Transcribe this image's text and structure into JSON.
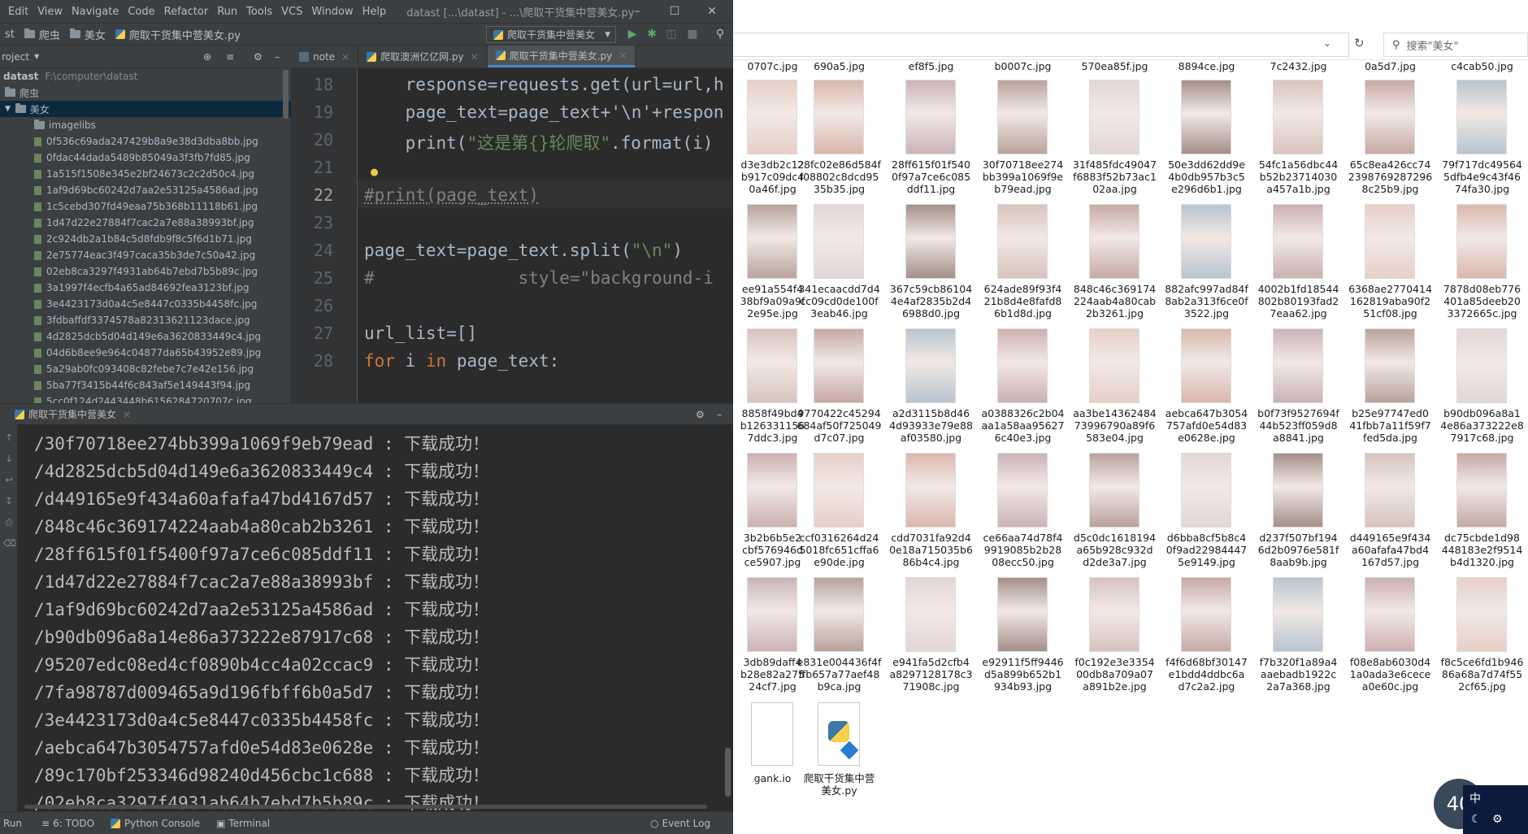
{
  "ide": {
    "menu": [
      "Edit",
      "View",
      "Navigate",
      "Code",
      "Refactor",
      "Run",
      "Tools",
      "VCS",
      "Window",
      "Help"
    ],
    "window_title": "datast [...\\datast] - ...\\爬取干货集中营美女.py",
    "breadcrumbs": [
      "st",
      "爬虫",
      "美女",
      "爬取干货集中营美女.py"
    ],
    "run_config": "爬取干货集中营美女",
    "project_label": "roject",
    "tabs": [
      {
        "label": "note",
        "active": false
      },
      {
        "label": "爬取澳洲亿亿网.py",
        "active": false
      },
      {
        "label": "爬取干货集中营美女.py",
        "active": true
      }
    ],
    "tree": {
      "root": "datast",
      "root_path": "F:\\computer\\datast",
      "folder1": "爬虫",
      "folder2": "美女",
      "folder3": "imagelibs",
      "files": [
        "0f536c69ada247429b8a9e38d3dba8bb.jpg",
        "0fdac44dada5489b85049a3f3fb7fd85.jpg",
        "1a515f1508e345e2bf24673c2c2d50c4.jpg",
        "1af9d69bc60242d7aa2e53125a4586ad.jpg",
        "1c5cebd307fd49eaa75b368b11118b61.jpg",
        "1d47d22e27884f7cac2a7e88a38993bf.jpg",
        "2c924db2a1b84c5d8fdb9f8c5f6d1b71.jpg",
        "2e75774eac3f497caca35b3de7c50a42.jpg",
        "02eb8ca3297f4931ab64b7ebd7b5b89c.jpg",
        "3a1997f4ecfb4a65ad84692fea3123bf.jpg",
        "3e4423173d0a4c5e8447c0335b4458fc.jpg",
        "3fdbaffdf3374578a82313621123dace.jpg",
        "4d2825dcb5d04d149e6a3620833449c4.jpg",
        "04d6b8ee9e964c04877da65b43952e89.jpg",
        "5a29ab0fc093408c82febe7c7e42e156.jpg",
        "5ba77f3415b44f6c843af5e149443f94.jpg",
        "5cc0f124d2443448b6156284720707c.jpg"
      ]
    },
    "line_numbers": [
      "18",
      "19",
      "20",
      "21",
      "22",
      "23",
      "24",
      "25",
      "26",
      "27",
      "28"
    ],
    "code": {
      "l18": "    response=requests.get(url=url,h",
      "l19": "    page_text=page_text+'\\n'+respon",
      "l20_a": "    print(",
      "l20_b": "\"这是第{}轮爬取\"",
      "l20_c": ".format(i)",
      "l22": "#print(page_text)",
      "l24_a": "page_text=page_text.split(",
      "l24_b": "\"\\n\"",
      "l24_c": ")",
      "l25": "#              style=\"background-i",
      "l27": "url_list=[]",
      "l28_kw1": "for",
      "l28_mid": " i ",
      "l28_kw2": "in",
      "l28_end": " page_text:"
    },
    "run_tab": "爬取干货集中营美女",
    "console": [
      "/30f70718ee274bb399a1069f9eb79ead : 下载成功！",
      "/4d2825dcb5d04d149e6a3620833449c4 : 下载成功！",
      "/d449165e9f434a60afafa47bd4167d57 : 下载成功！",
      "/848c46c369174224aab4a80cab2b3261 : 下载成功！",
      "/28ff615f01f5400f97a7ce6c085ddf11 : 下载成功！",
      "/1d47d22e27884f7cac2a7e88a38993bf : 下载成功！",
      "/1af9d69bc60242d7aa2e53125a4586ad : 下载成功！",
      "/b90db096a8a14e86a373222e87917c68 : 下载成功！",
      "/95207edc08ed4cf0890b4cc4a02ccac9 : 下载成功！",
      "/7fa98787d009465a9d196fbff6b0a5d7 : 下载成功！",
      "/3e4423173d0a4c5e8447c0335b4458fc : 下载成功！",
      "/aebca647b3054757afd0e54d83e0628e : 下载成功！",
      "/89c170bf253346d98240d456cbc1c688 : 下载成功！",
      "/02eb8ca3297f4931ab64b7ebd7b5b89c : 下载成功！"
    ],
    "status": {
      "run": "Run",
      "todo": "6: TODO",
      "python_console": "Python Console",
      "terminal": "Terminal",
      "event_log": "Event Log"
    }
  },
  "explorer": {
    "search_placeholder": "搜索\"美女\"",
    "top_row": [
      "0707c.jpg",
      "690a5.jpg",
      "ef8f5.jpg",
      "b0007c.jpg",
      "570ea85f.jpg",
      "8894ce.jpg",
      "7c2432.jpg",
      "0a5d7.jpg",
      "c4cab50.jpg"
    ],
    "rows": [
      [
        "d3e3db2c12\nb917c09dc4\n0a46f.jpg",
        "28fc02e86d584f\nf08802c8dcd95\n35b35.jpg",
        "28ff615f01f540\n0f97a7ce6c085\nddf11.jpg",
        "30f70718ee274\nbb399a1069f9e\nb79ead.jpg",
        "31f485fdc49047\nf6883f52b73ac1\n02aa.jpg",
        "50e3dd62dd9e\n4b0db957b3c5\ne296d6b1.jpg",
        "54fc1a56dbc44\nb52b23714030\na457a1b.jpg",
        "65c8ea426cc74\n2398769287296\n8c25b9.jpg",
        "79f717dc49564\n5dfb4e9c43f46\n74fa30.jpg"
      ],
      [
        "ee91a554f4\n38bf9a09a9f\n2e95e.jpg",
        "341ecaacdd7d4\ncc09cd0de100f\n3eab46.jpg",
        "367c59cb86104\n4e4af2835b2d4\n6988d0.jpg",
        "624ade89f93f4\n21b8d4e8fafd8\n6b1d8d.jpg",
        "848c46c369174\n224aab4a80cab\n2b3261.jpg",
        "882afc997ad84f\n8ab2a313f6ce0f\n3522.jpg",
        "4002b1fd18544\n802b80193fad2\n7eaa62.jpg",
        "6368ae2770414\n162819aba90f2\n51cf08.jpg",
        "7878d08eb776\n401a85deeb20\n3372665c.jpg"
      ],
      [
        "8858f49bd4\nb126331156\n7ddc3.jpg",
        "9770422c45294\n684af50f725049\nd7c07.jpg",
        "a2d3115b8d46\n4d93933e79e88\naf03580.jpg",
        "a0388326c2b04\naa1a58aa95627\n6c40e3.jpg",
        "aa3be14362484\n73996790a89f6\n583e04.jpg",
        "aebca647b3054\n757afd0e54d83\ne0628e.jpg",
        "b0f73f9527694f\n44b523ff059d8\na8841.jpg",
        "b25e97747ed0\n41fbb7a11f59f7\nfed5da.jpg",
        "b90db096a8a1\n4e86a373222e8\n7917c68.jpg"
      ],
      [
        "3b2b6b5e2\ncbf576946d\nce5907.jpg",
        "ccf0316264d24\n5018fc651cffa6\ne90de.jpg",
        "cdd7031fa92d4\n0e18a715035b6\n86b4c4.jpg",
        "ce66aa74d78f4\n9919085b2b28\n08ecc50.jpg",
        "d5c0dc1618194\na65b928c932d\nd2de3a7.jpg",
        "d6bba8cf5b8c4\n0f9ad22984447\n5e9149.jpg",
        "d237f507bf194\n6d2b0976e581f\n8aab9b.jpg",
        "d449165e9f434\na60afafa47bd4\n167d57.jpg",
        "dc75cbde1d98\n448183e2f9514\nb4d1320.jpg"
      ],
      [
        "3db89daff4\nb28e82a275\n24cf7.jpg",
        "e831e004436f4f\nffb657a77aef48\nb9ca.jpg",
        "e941fa5d2cfb4\na8297128178c3\n71908c.jpg",
        "e92911f5ff9446\nd5a899b652b1\n934b93.jpg",
        "f0c192e3e3354\n00db8a709a07\na891b2e.jpg",
        "f4f6d68bf30147\ne1bdd4ddbc6a\nd7c2a2.jpg",
        "f7b320f1a89a4\naaebadb1922c\n2a7a368.jpg",
        "f08e8ab6030d4\n1a0ada3e6cece\na0e60c.jpg",
        "f8c5ce6fd1b946\n86a68a7d74f55\n2cf65.jpg"
      ]
    ],
    "bottom_files": [
      "gank.io",
      "爬取干货集中营\n美女.py"
    ],
    "badge": "40"
  }
}
